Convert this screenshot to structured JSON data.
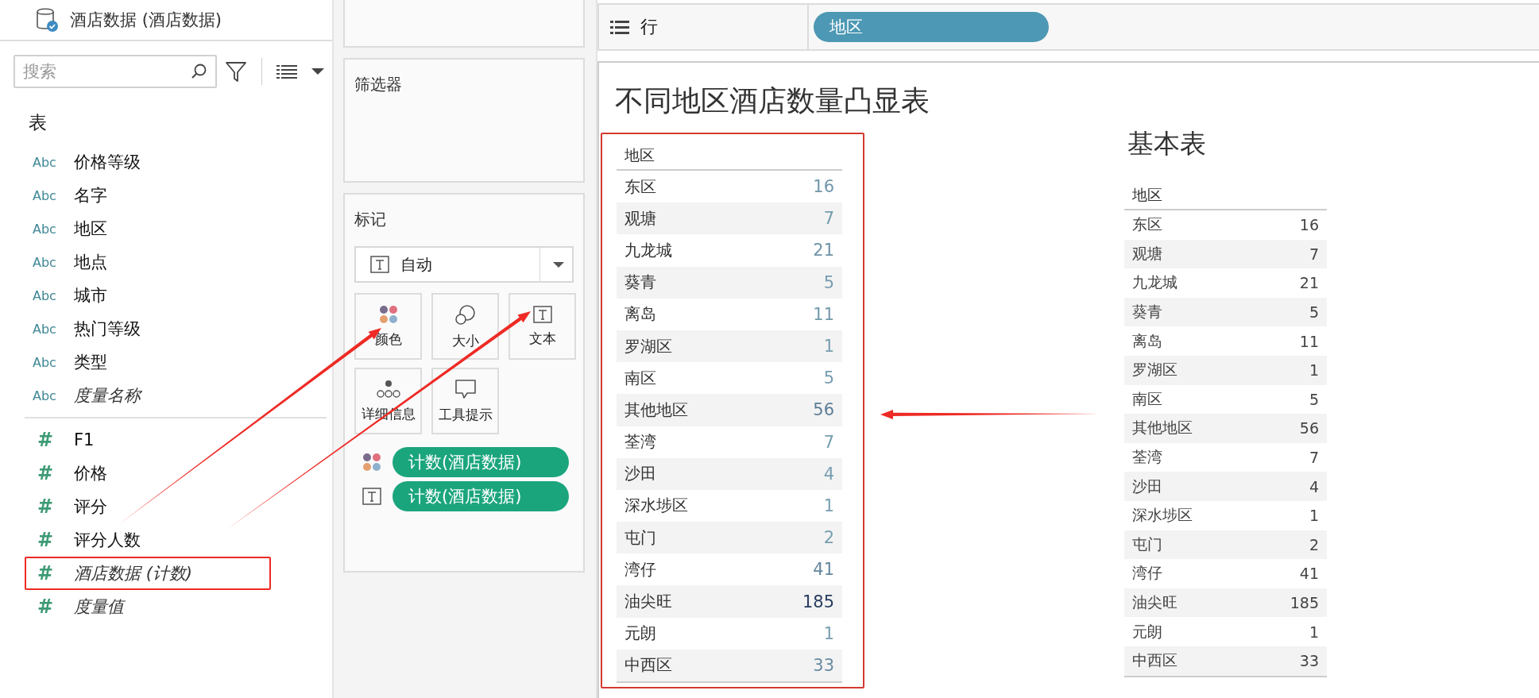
{
  "data_source": {
    "title": "酒店数据 (酒店数据)"
  },
  "search": {
    "placeholder": "搜索"
  },
  "fields": {
    "heading": "表",
    "items": [
      {
        "kind": "dimension",
        "type_icon": "Abc",
        "label": "价格等级",
        "italic": false,
        "highlighted": false
      },
      {
        "kind": "dimension",
        "type_icon": "Abc",
        "label": "名字",
        "italic": false,
        "highlighted": false
      },
      {
        "kind": "dimension",
        "type_icon": "Abc",
        "label": "地区",
        "italic": false,
        "highlighted": false
      },
      {
        "kind": "dimension",
        "type_icon": "Abc",
        "label": "地点",
        "italic": false,
        "highlighted": false
      },
      {
        "kind": "dimension",
        "type_icon": "Abc",
        "label": "城市",
        "italic": false,
        "highlighted": false
      },
      {
        "kind": "dimension",
        "type_icon": "Abc",
        "label": "热门等级",
        "italic": false,
        "highlighted": false
      },
      {
        "kind": "dimension",
        "type_icon": "Abc",
        "label": "类型",
        "italic": false,
        "highlighted": false
      },
      {
        "kind": "dimension",
        "type_icon": "Abc",
        "label": "度量名称",
        "italic": true,
        "highlighted": false
      },
      {
        "kind": "measure",
        "type_icon": "#",
        "label": "F1",
        "italic": false,
        "highlighted": false
      },
      {
        "kind": "measure",
        "type_icon": "#",
        "label": "价格",
        "italic": false,
        "highlighted": false
      },
      {
        "kind": "measure",
        "type_icon": "#",
        "label": "评分",
        "italic": false,
        "highlighted": false
      },
      {
        "kind": "measure",
        "type_icon": "#",
        "label": "评分人数",
        "italic": false,
        "highlighted": false
      },
      {
        "kind": "measure",
        "type_icon": "#",
        "label": "酒店数据 (计数)",
        "italic": true,
        "highlighted": true
      },
      {
        "kind": "measure",
        "type_icon": "#",
        "label": "度量值",
        "italic": true,
        "highlighted": false
      }
    ]
  },
  "filters_card": {
    "title": "筛选器"
  },
  "marks_card": {
    "title": "标记",
    "mark_type": "自动",
    "buttons": [
      {
        "kind": "color",
        "label": "颜色"
      },
      {
        "kind": "size",
        "label": "大小"
      },
      {
        "kind": "text",
        "label": "文本"
      },
      {
        "kind": "detail",
        "label": "详细信息"
      },
      {
        "kind": "tooltip",
        "label": "工具提示"
      }
    ],
    "pills": [
      {
        "kind": "color",
        "label": "计数(酒店数据)"
      },
      {
        "kind": "text",
        "label": "计数(酒店数据)"
      }
    ]
  },
  "rows_shelf": {
    "label": "行",
    "pills": [
      "地区"
    ]
  },
  "highlight_table": {
    "title": "不同地区酒店数量凸显表",
    "column": "地区",
    "rows": [
      {
        "region": "东区",
        "count": "16"
      },
      {
        "region": "观塘",
        "count": "7"
      },
      {
        "region": "九龙城",
        "count": "21"
      },
      {
        "region": "葵青",
        "count": "5"
      },
      {
        "region": "离岛",
        "count": "11"
      },
      {
        "region": "罗湖区",
        "count": "1"
      },
      {
        "region": "南区",
        "count": "5"
      },
      {
        "region": "其他地区",
        "count": "56"
      },
      {
        "region": "荃湾",
        "count": "7"
      },
      {
        "region": "沙田",
        "count": "4"
      },
      {
        "region": "深水埗区",
        "count": "1"
      },
      {
        "region": "屯门",
        "count": "2"
      },
      {
        "region": "湾仔",
        "count": "41"
      },
      {
        "region": "油尖旺",
        "count": "185"
      },
      {
        "region": "元朗",
        "count": "1"
      },
      {
        "region": "中西区",
        "count": "33"
      }
    ]
  },
  "basic_table": {
    "title": "基本表",
    "column": "地区",
    "rows": [
      {
        "region": "东区",
        "count": "16"
      },
      {
        "region": "观塘",
        "count": "7"
      },
      {
        "region": "九龙城",
        "count": "21"
      },
      {
        "region": "葵青",
        "count": "5"
      },
      {
        "region": "离岛",
        "count": "11"
      },
      {
        "region": "罗湖区",
        "count": "1"
      },
      {
        "region": "南区",
        "count": "5"
      },
      {
        "region": "其他地区",
        "count": "56"
      },
      {
        "region": "荃湾",
        "count": "7"
      },
      {
        "region": "沙田",
        "count": "4"
      },
      {
        "region": "深水埗区",
        "count": "1"
      },
      {
        "region": "屯门",
        "count": "2"
      },
      {
        "region": "湾仔",
        "count": "41"
      },
      {
        "region": "油尖旺",
        "count": "185"
      },
      {
        "region": "元朗",
        "count": "1"
      },
      {
        "region": "中西区",
        "count": "33"
      }
    ]
  }
}
